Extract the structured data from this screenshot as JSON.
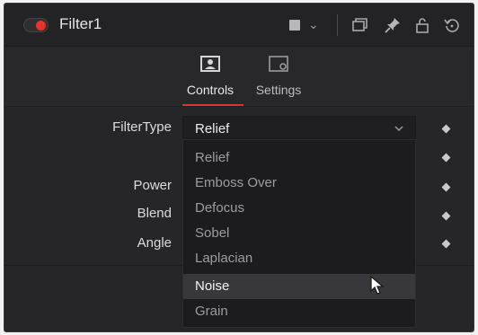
{
  "header": {
    "title": "Filter1",
    "enabled": true,
    "accent_color": "#e8332b"
  },
  "tabs": [
    {
      "label": "Controls",
      "icon": "controls-icon",
      "active": true
    },
    {
      "label": "Settings",
      "icon": "settings-icon",
      "active": false
    }
  ],
  "params": {
    "filter_type_label": "FilterType",
    "filter_type_value": "Relief",
    "power_label": "Power",
    "blend_label": "Blend",
    "angle_label": "Angle"
  },
  "dropdown": {
    "options": [
      "Relief",
      "Emboss Over",
      "Defocus",
      "Sobel",
      "Laplacian",
      "Noise",
      "Grain"
    ],
    "highlighted": "Noise"
  }
}
